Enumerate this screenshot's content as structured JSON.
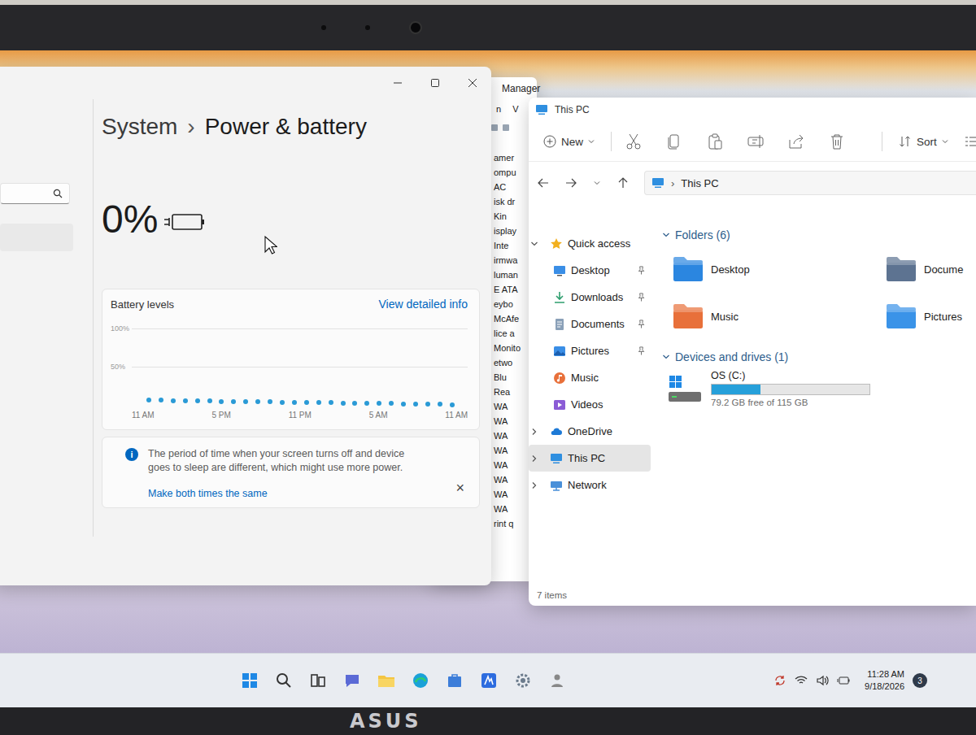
{
  "device": {
    "brand": "ASUS"
  },
  "settings": {
    "breadcrumb": {
      "parent": "System",
      "separator": "›",
      "current": "Power & battery"
    },
    "battery": {
      "percent": "0%",
      "level": 0
    },
    "chart": {
      "title": "Battery levels",
      "link": "View detailed info",
      "ticks": [
        "100%",
        "50%"
      ],
      "labels": [
        "11 AM",
        "5 PM",
        "11 PM",
        "5 AM",
        "11 AM"
      ],
      "series": [
        {
          "name": "battery",
          "values": [
            6,
            6,
            5,
            5,
            5,
            5,
            4,
            4,
            4,
            4,
            4,
            3,
            3,
            3,
            3,
            3,
            2,
            2,
            2,
            2,
            2,
            1,
            1,
            1,
            1,
            0
          ]
        }
      ]
    },
    "notice": {
      "icon": "i",
      "text": "The period of time when your screen turns off and device goes to sleep are different, which might use more power.",
      "link": "Make both times the same",
      "close": "×"
    }
  },
  "device_manager": {
    "title": "Manager",
    "menu": [
      "n",
      "V"
    ],
    "items": [
      "amer",
      "ompu",
      "AC",
      "isk dr",
      "Kin",
      "isplay",
      "Inte",
      "irmwa",
      "luman",
      "E ATA",
      "eybo",
      "McAfe",
      "lice a",
      "Monito",
      "etwo",
      "Blu",
      "Rea",
      "WA",
      "WA",
      "WA",
      "WA",
      "WA",
      "WA",
      "WA",
      "WA",
      "rint q"
    ]
  },
  "explorer": {
    "title": "This PC",
    "toolbar": {
      "new": "New",
      "sort": "Sort"
    },
    "address": {
      "separator": "›",
      "path": "This PC"
    },
    "nav": [
      {
        "label": "Quick access",
        "kind": "group",
        "expanded": true,
        "selected": false,
        "pinned": false
      },
      {
        "label": "Desktop",
        "kind": "item",
        "expanded": false,
        "selected": false,
        "pinned": true
      },
      {
        "label": "Downloads",
        "kind": "item",
        "expanded": false,
        "selected": false,
        "pinned": true
      },
      {
        "label": "Documents",
        "kind": "item",
        "expanded": false,
        "selected": false,
        "pinned": true
      },
      {
        "label": "Pictures",
        "kind": "item",
        "expanded": false,
        "selected": false,
        "pinned": true
      },
      {
        "label": "Music",
        "kind": "item",
        "expanded": false,
        "selected": false,
        "pinned": false
      },
      {
        "label": "Videos",
        "kind": "item",
        "expanded": false,
        "selected": false,
        "pinned": false
      },
      {
        "label": "OneDrive",
        "kind": "group",
        "expanded": false,
        "selected": false,
        "pinned": false
      },
      {
        "label": "This PC",
        "kind": "group",
        "expanded": false,
        "selected": true,
        "pinned": false
      },
      {
        "label": "Network",
        "kind": "group",
        "expanded": false,
        "selected": false,
        "pinned": false
      }
    ],
    "folders": {
      "header": "Folders (6)",
      "expanded": true,
      "items": [
        {
          "label": "Desktop",
          "color": "#2b86e0"
        },
        {
          "label": "Music",
          "color": "#e8703a"
        },
        {
          "label": "Docume",
          "color": "#5d7391"
        },
        {
          "label": "Pictures",
          "color": "#3a93e8"
        }
      ]
    },
    "drives": {
      "header": "Devices and drives (1)",
      "expanded": true,
      "items": [
        {
          "label": "OS (C:)",
          "free": "79.2 GB free of 115 GB",
          "level": 0.31
        }
      ]
    },
    "status_bar": "7 items"
  },
  "taskbar": {
    "time": "11:28 AM",
    "date": "9/18/2026",
    "badge": "3"
  }
}
